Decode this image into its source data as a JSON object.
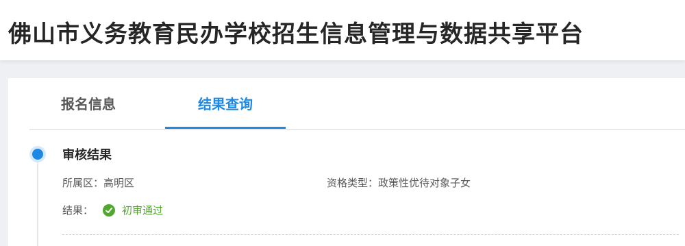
{
  "app": {
    "title": "佛山市义务教育民办学校招生信息管理与数据共享平台"
  },
  "tabs": [
    {
      "label": "报名信息",
      "active": false
    },
    {
      "label": "结果查询",
      "active": true
    }
  ],
  "review": {
    "section_title": "审核结果",
    "district_label": "所属区：",
    "district_value": "高明区",
    "qualification_label": "资格类型：",
    "qualification_value": "政策性优待对象子女",
    "result_label": "结果：",
    "result_value": "初审通过",
    "result_icon": "check-circle-icon"
  },
  "colors": {
    "accent": "#1e88e5",
    "success": "#52a82e"
  }
}
